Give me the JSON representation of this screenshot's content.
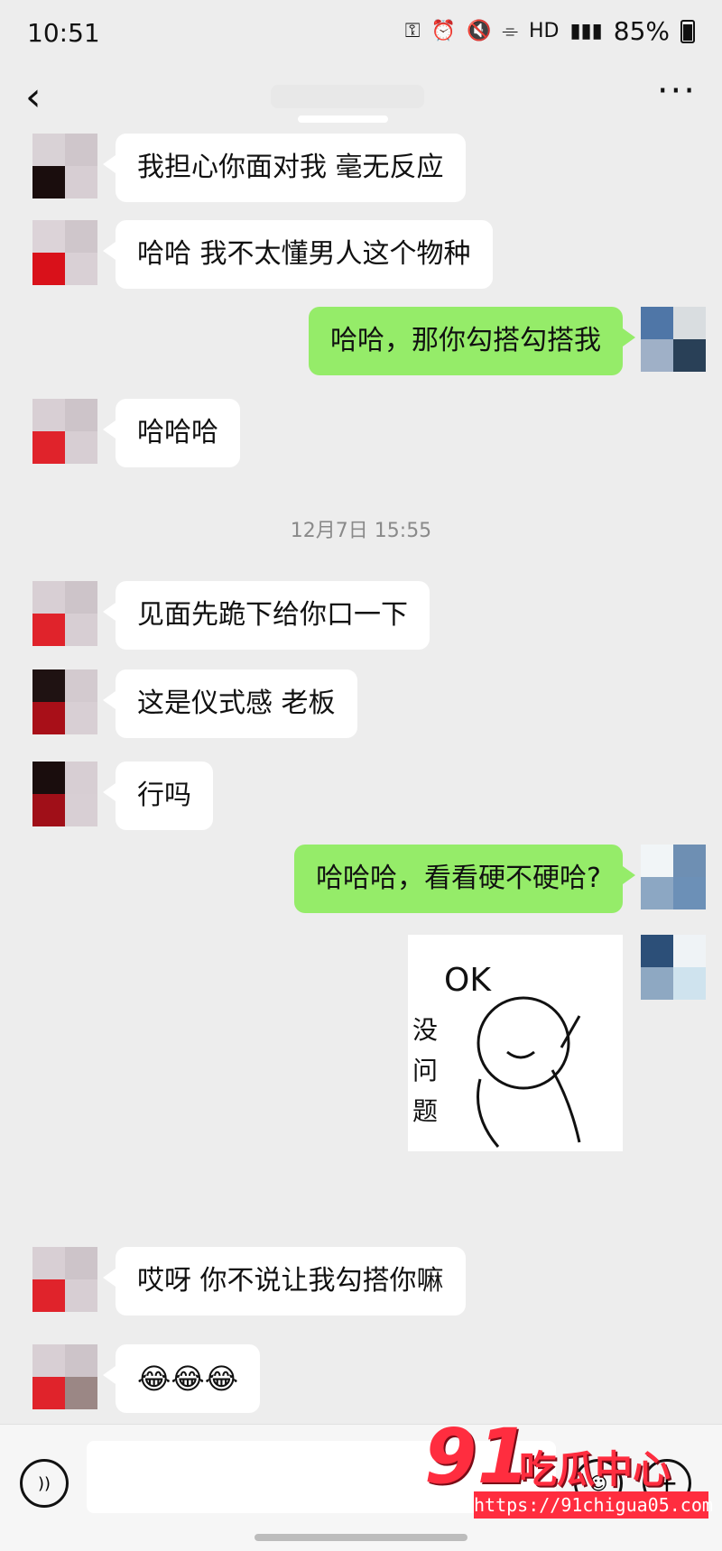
{
  "status_bar": {
    "time": "10:51",
    "network_label": "HD",
    "battery": "85%"
  },
  "messages": [
    {
      "side": "left",
      "text": "我担心你面对我 毫无反应"
    },
    {
      "side": "left",
      "text": "哈哈 我不太懂男人这个物种"
    },
    {
      "side": "right",
      "text": "哈哈，那你勾搭勾搭我"
    },
    {
      "side": "left",
      "text": "哈哈哈"
    },
    {
      "side": "timestamp",
      "text": "12月7日 15:55"
    },
    {
      "side": "left",
      "text": "见面先跪下给你口一下"
    },
    {
      "side": "left",
      "text": "这是仪式感 老板"
    },
    {
      "side": "left",
      "text": "行吗"
    },
    {
      "side": "right",
      "text": "哈哈哈，看看硬不硬哈?"
    },
    {
      "side": "right",
      "type": "sticker",
      "sticker_text": "OK 没问题"
    },
    {
      "side": "left",
      "text": "哎呀 你不说让我勾搭你嘛"
    },
    {
      "side": "left",
      "emoji": "😂😂😂"
    }
  ],
  "watermark": {
    "brand_num": "91",
    "brand_cn": "吃瓜中心",
    "url": "https://91chigua05.com"
  }
}
